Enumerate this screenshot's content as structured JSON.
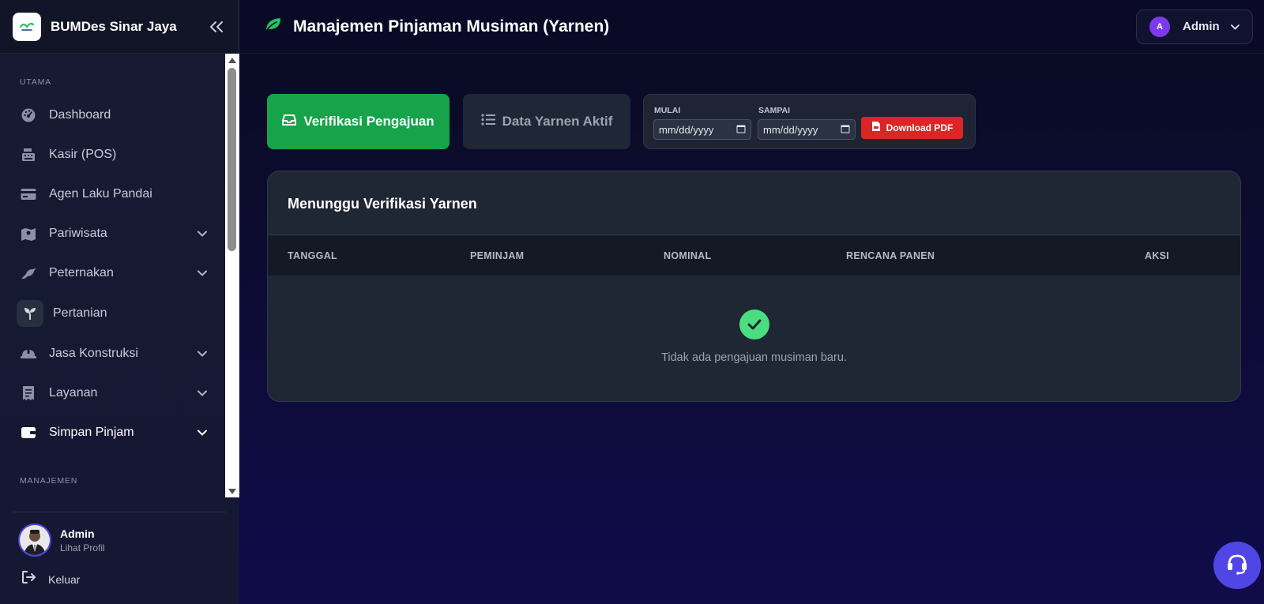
{
  "brand": {
    "name": "BUMDes Sinar Jaya"
  },
  "sidebar": {
    "section_main": "UTAMA",
    "section_manage": "MANAJEMEN",
    "items": [
      {
        "label": "Dashboard",
        "icon": "dashboard-gauge-icon"
      },
      {
        "label": "Kasir (POS)",
        "icon": "cash-register-icon"
      },
      {
        "label": "Agen Laku Pandai",
        "icon": "credit-card-icon"
      },
      {
        "label": "Pariwisata",
        "icon": "map-icon",
        "has_children": true
      },
      {
        "label": "Peternakan",
        "icon": "bird-icon",
        "has_children": true
      },
      {
        "label": "Pertanian",
        "icon": "seedling-icon",
        "highlighted": true
      },
      {
        "label": "Jasa Konstruksi",
        "icon": "hard-hat-icon",
        "has_children": true
      },
      {
        "label": "Layanan",
        "icon": "receipt-icon",
        "has_children": true
      },
      {
        "label": "Simpan Pinjam",
        "icon": "wallet-icon",
        "has_children": true,
        "active": true
      }
    ]
  },
  "footer": {
    "user_name": "Admin",
    "profile_link": "Lihat Profil",
    "logout_label": "Keluar"
  },
  "header": {
    "title": "Manajemen Pinjaman Musiman (Yarnen)",
    "user_initial": "A",
    "user_name": "Admin"
  },
  "actions": {
    "verify_label": "Verifikasi Pengajuan",
    "active_data_label": "Data Yarnen Aktif"
  },
  "filter": {
    "start_label": "MULAI",
    "start_placeholder": "mm/dd/yyyy",
    "end_label": "SAMPAI",
    "end_placeholder": "mm/dd/yyyy",
    "download_label": "Download PDF"
  },
  "table": {
    "title": "Menunggu Verifikasi Yarnen",
    "columns": [
      "TANGGAL",
      "PEMINJAM",
      "NOMINAL",
      "RENCANA PANEN",
      "AKSI"
    ],
    "empty_message": "Tidak ada pengajuan musiman baru."
  },
  "colors": {
    "accent_green": "#16a34a",
    "danger_red": "#dc2626",
    "brand_indigo": "#4f46e5",
    "success_light": "#4ade80"
  }
}
